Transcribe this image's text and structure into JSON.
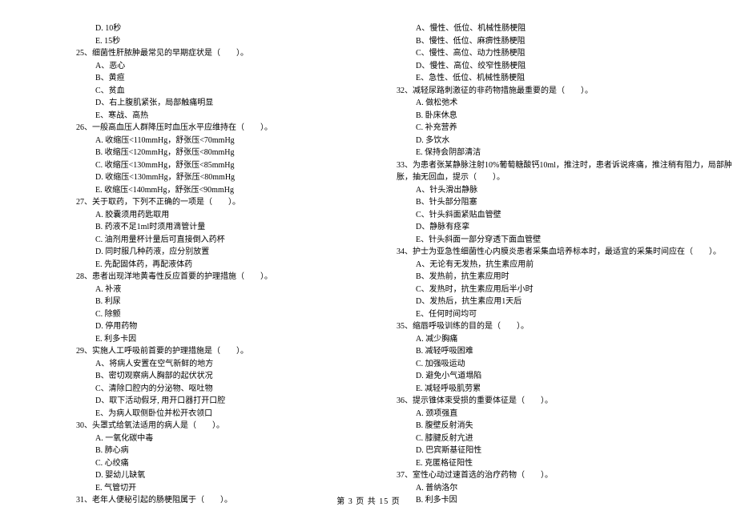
{
  "left_lines": [
    {
      "cls": "option-line",
      "text": "D. 10秒"
    },
    {
      "cls": "option-line",
      "text": "E. 15秒"
    },
    {
      "cls": "question-line",
      "text": "25、细菌性肝脓肿最常见的早期症状是（　　）。"
    },
    {
      "cls": "option-line",
      "text": "A、恶心"
    },
    {
      "cls": "option-line",
      "text": "B、黄疸"
    },
    {
      "cls": "option-line",
      "text": "C、贫血"
    },
    {
      "cls": "option-line",
      "text": "D、右上腹肌紧张，局部触痛明显"
    },
    {
      "cls": "option-line",
      "text": "E、寒战、高热"
    },
    {
      "cls": "question-line",
      "text": "26、一般高血压人群降压时血压水平应维持在（　　）。"
    },
    {
      "cls": "option-line",
      "text": "A. 收缩压<110mmHg，舒张压<70mmHg"
    },
    {
      "cls": "option-line",
      "text": "B. 收缩压<120mmHg，舒张压<80mmHg"
    },
    {
      "cls": "option-line",
      "text": "C. 收缩压<130mmHg，舒张压<85mmHg"
    },
    {
      "cls": "option-line",
      "text": "D. 收缩压<130mmHg，舒张压<80mmHg"
    },
    {
      "cls": "option-line",
      "text": "E. 收缩压<140mmHg，舒张压<90mmHg"
    },
    {
      "cls": "question-line",
      "text": "27、关于取药，下列不正确的一项是（　　）。"
    },
    {
      "cls": "option-line",
      "text": "A. 胶囊须用药匙取用"
    },
    {
      "cls": "option-line",
      "text": "B. 药液不足1ml时须用滴管计量"
    },
    {
      "cls": "option-line",
      "text": "C. 油剂用量杯计量后可直接倒入药杯"
    },
    {
      "cls": "option-line",
      "text": "D. 同时服几种药液，应分别放置"
    },
    {
      "cls": "option-line",
      "text": "E. 先配固体药，再配液体药"
    },
    {
      "cls": "question-line",
      "text": "28、患者出现洋地黄毒性反应首要的护理措施（　　）。"
    },
    {
      "cls": "option-line",
      "text": "A.  补液"
    },
    {
      "cls": "option-line",
      "text": "B.  利尿"
    },
    {
      "cls": "option-line",
      "text": "C.  除颤"
    },
    {
      "cls": "option-line",
      "text": "D.  停用药物"
    },
    {
      "cls": "option-line",
      "text": "E.  利多卡因"
    },
    {
      "cls": "question-line",
      "text": "29、实施人工呼吸前首要的护理措施是（　　）。"
    },
    {
      "cls": "option-line",
      "text": "A、将病人安置在空气新鲜的地方"
    },
    {
      "cls": "option-line",
      "text": "B、密切观察病人胸部的起伏状况"
    },
    {
      "cls": "option-line",
      "text": "C、清除口腔内的分泌物、呕吐物"
    },
    {
      "cls": "option-line",
      "text": "D、取下活动假牙, 用开口器打开口腔"
    },
    {
      "cls": "option-line",
      "text": "E、为病人取侧卧位并松开衣领口"
    },
    {
      "cls": "question-line",
      "text": "30、头罩式给氧法适用的病人是（　　）。"
    },
    {
      "cls": "option-line",
      "text": "A. 一氧化碳中毒"
    },
    {
      "cls": "option-line",
      "text": "B. 肺心病"
    },
    {
      "cls": "option-line",
      "text": "C. 心绞痛"
    },
    {
      "cls": "option-line",
      "text": "D. 婴幼儿缺氧"
    },
    {
      "cls": "option-line",
      "text": "E. 气管切开"
    },
    {
      "cls": "question-line",
      "text": "31、老年人便秘引起的肠梗阻属于（　　）。"
    }
  ],
  "right_lines": [
    {
      "cls": "option-line",
      "text": "A、慢性、低位、机械性肠梗阻"
    },
    {
      "cls": "option-line",
      "text": "B、慢性、低位、麻痹性肠梗阻"
    },
    {
      "cls": "option-line",
      "text": "C、慢性、高位、动力性肠梗阻"
    },
    {
      "cls": "option-line",
      "text": "D、慢性、高位、绞窄性肠梗阻"
    },
    {
      "cls": "option-line",
      "text": "E、急性、低位、机械性肠梗阻"
    },
    {
      "cls": "question-line",
      "text": "32、减轻尿路刺激征的非药物措施最重要的是（　　）。"
    },
    {
      "cls": "option-line",
      "text": "A. 做松弛术"
    },
    {
      "cls": "option-line",
      "text": "B. 卧床休息"
    },
    {
      "cls": "option-line",
      "text": "C. 补充营养"
    },
    {
      "cls": "option-line",
      "text": "D. 多饮水"
    },
    {
      "cls": "option-line",
      "text": "E. 保持会阴部清洁"
    },
    {
      "cls": "question-line",
      "text": "33、为患者张某静脉注射10%葡萄糖酸钙10ml，推注时，患者诉说疼痛，推注稍有阻力，局部肿"
    },
    {
      "cls": "question-line-indent",
      "text": "胀，抽无回血，提示（　　）。"
    },
    {
      "cls": "option-line",
      "text": "A、针头滑出静脉"
    },
    {
      "cls": "option-line",
      "text": "B、针头部分阻塞"
    },
    {
      "cls": "option-line",
      "text": "C、针头斜面紧贴血管壁"
    },
    {
      "cls": "option-line",
      "text": "D、静脉有痉挛"
    },
    {
      "cls": "option-line",
      "text": "E、针头斜面一部分穿透下面血管壁"
    },
    {
      "cls": "question-line",
      "text": "34、护士为亚急性细菌性心内膜炎患者采集血培养标本时，最适宜的采集时间应在（　　）。"
    },
    {
      "cls": "option-line",
      "text": "A、无论有无发热，抗生素应用前"
    },
    {
      "cls": "option-line",
      "text": "B、发热前，抗生素应用时"
    },
    {
      "cls": "option-line",
      "text": "C、发热时，抗生素应用后半小时"
    },
    {
      "cls": "option-line",
      "text": "D、发热后，抗生素应用1天后"
    },
    {
      "cls": "option-line",
      "text": "E、任何时间均可"
    },
    {
      "cls": "question-line",
      "text": "35、缩唇呼吸训练的目的是（　　）。"
    },
    {
      "cls": "option-line",
      "text": "A.  减少胸痛"
    },
    {
      "cls": "option-line",
      "text": "B.  减轻呼吸困难"
    },
    {
      "cls": "option-line",
      "text": "C.  加强吸运动"
    },
    {
      "cls": "option-line",
      "text": "D.  避免小气道塌陷"
    },
    {
      "cls": "option-line",
      "text": "E.  减轻呼吸肌劳累"
    },
    {
      "cls": "question-line",
      "text": "36、提示锥体束受损的重要体征是（　　）。"
    },
    {
      "cls": "option-line",
      "text": "A.  颈项强直"
    },
    {
      "cls": "option-line",
      "text": "B.  腹壁反射消失"
    },
    {
      "cls": "option-line",
      "text": "C.  膝腱反射亢进"
    },
    {
      "cls": "option-line",
      "text": "D.  巴宾斯基征阳性"
    },
    {
      "cls": "option-line",
      "text": "E.  克匿格征阳性"
    },
    {
      "cls": "question-line",
      "text": "37、室性心动过速首选的治疗药物（　　）。"
    },
    {
      "cls": "option-line",
      "text": "A.  普纳洛尔"
    },
    {
      "cls": "option-line",
      "text": "B.  利多卡因"
    }
  ],
  "footer": "第 3 页 共 15 页"
}
